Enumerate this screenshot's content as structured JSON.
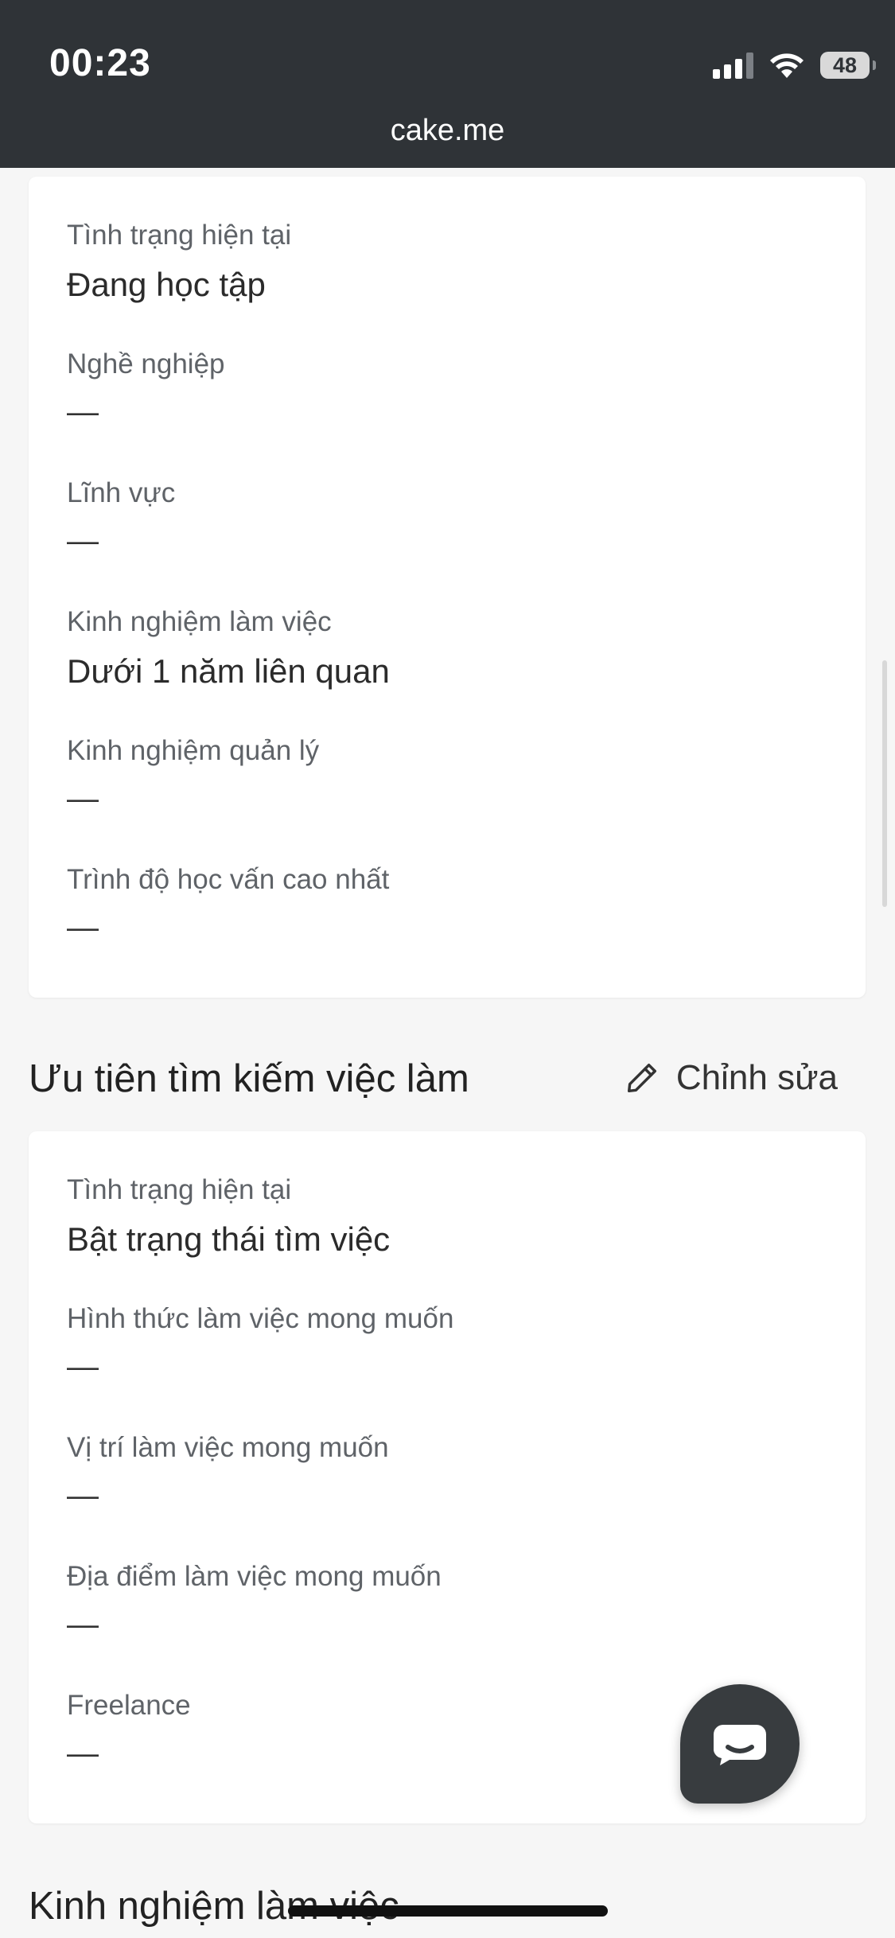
{
  "status_bar": {
    "time": "00:23",
    "battery": "48",
    "signal_icon": "cellular-signal-icon",
    "wifi_icon": "wifi-icon"
  },
  "browser": {
    "url": "cake.me"
  },
  "profile_info": {
    "fields": [
      {
        "label": "Tình trạng hiện tại",
        "value": "Đang học tập"
      },
      {
        "label": "Nghề nghiệp",
        "value": "—"
      },
      {
        "label": "Lĩnh vực",
        "value": "—"
      },
      {
        "label": "Kinh nghiệm làm việc",
        "value": "Dưới 1 năm liên quan"
      },
      {
        "label": "Kinh nghiệm quản lý",
        "value": "—"
      },
      {
        "label": "Trình độ học vấn cao nhất",
        "value": "—"
      }
    ]
  },
  "job_preferences": {
    "title": "Ưu tiên tìm kiếm việc làm",
    "edit_label": "Chỉnh sửa",
    "edit_icon": "pencil-icon",
    "fields": [
      {
        "label": "Tình trạng hiện tại",
        "value": "Bật trạng thái tìm việc"
      },
      {
        "label": "Hình thức làm việc mong muốn",
        "value": "—"
      },
      {
        "label": "Vị trí làm việc mong muốn",
        "value": "—"
      },
      {
        "label": "Địa điểm làm việc mong muốn",
        "value": "—"
      },
      {
        "label": "Freelance",
        "value": "—"
      }
    ]
  },
  "work_experience": {
    "title": "Kinh nghiệm làm việc"
  },
  "chat_button": {
    "icon": "chat-bubble-icon"
  },
  "colors": {
    "top_bar": "#2f3337",
    "page_background": "#f6f6f6",
    "card_background": "#ffffff",
    "label_text": "#5f6368",
    "value_text": "#2b2b2b"
  }
}
